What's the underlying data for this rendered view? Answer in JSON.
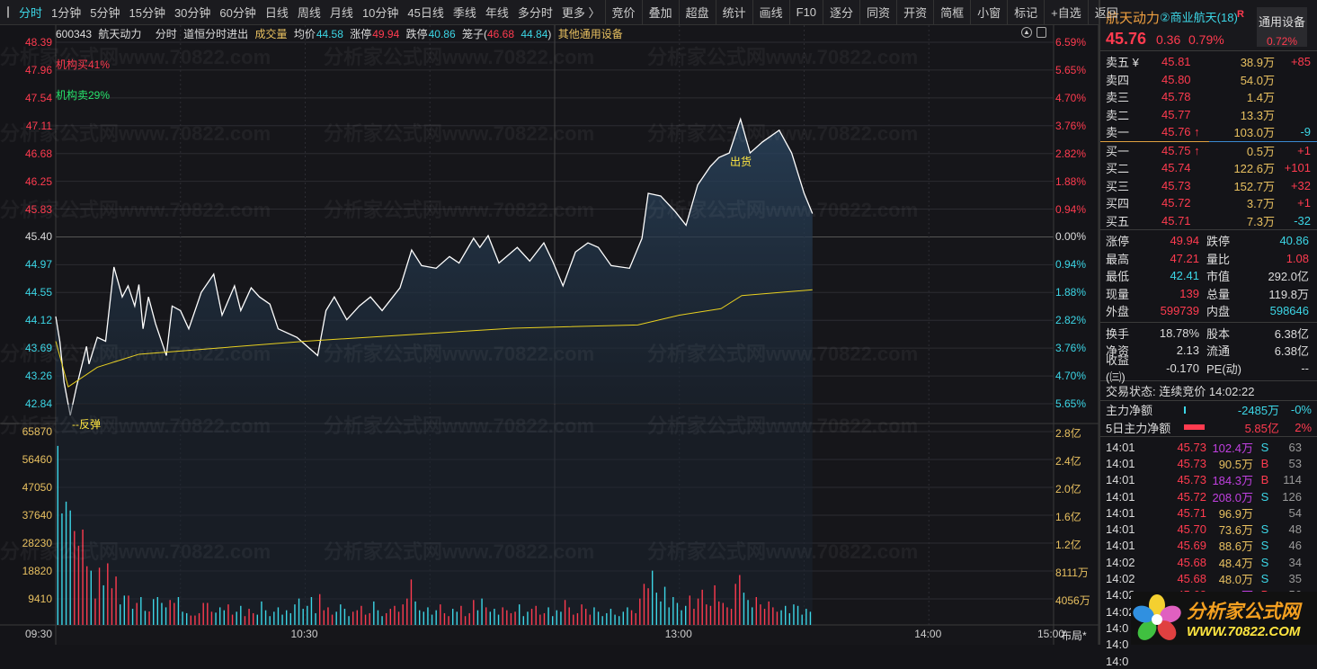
{
  "toolbar": {
    "periods": [
      "分时",
      "1分钟",
      "5分钟",
      "15分钟",
      "30分钟",
      "60分钟",
      "日线",
      "周线",
      "月线",
      "10分钟",
      "45日线",
      "季线",
      "年线",
      "多分时",
      "更多 〉"
    ],
    "actions": [
      "竞价",
      "叠加",
      "超盘",
      "统计",
      "画线",
      "F10",
      "逐分",
      "同资",
      "开资",
      "简框",
      "小窗",
      "标记",
      "+自选",
      "返回"
    ]
  },
  "header": {
    "code": "600343",
    "name": "航天动力",
    "mode": "分时",
    "indicator": "道恒分时进出",
    "vol_label": "成交量",
    "avg_label": "均价",
    "avg": "44.58",
    "up_label": "涨停",
    "up": "49.94",
    "down_label": "跌停",
    "down": "40.86",
    "cage_label": "笼子(",
    "cage_hi": "46.68",
    "cage_lo": "44.84",
    ")": ")",
    "industry": "其他通用设备"
  },
  "annotations": {
    "buy": "机构买41%",
    "sell": "机构卖29%",
    "rebound": "--反弹",
    "ship": "出货"
  },
  "watermark": "分析家公式网www.70822.com",
  "chart_data": {
    "type": "line",
    "price_axis": {
      "left": [
        "48.39",
        "47.96",
        "47.54",
        "47.11",
        "46.68",
        "46.25",
        "45.83",
        "45.40",
        "44.97",
        "44.55",
        "44.12",
        "43.69",
        "43.26",
        "42.84"
      ],
      "right": [
        "6.59%",
        "5.65%",
        "4.70%",
        "3.76%",
        "2.82%",
        "1.88%",
        "0.94%",
        "0.00%",
        "0.94%",
        "1.88%",
        "2.82%",
        "3.76%",
        "4.70%",
        "5.65%"
      ],
      "ylim": [
        42.84,
        48.39
      ],
      "prev_close": 45.4
    },
    "volume_axis": {
      "left": [
        "65870",
        "56460",
        "47050",
        "37640",
        "28230",
        "18820",
        "9410"
      ],
      "right": [
        "2.8亿",
        "2.4亿",
        "2.0亿",
        "1.6亿",
        "1.2亿",
        "8111万",
        "4056万"
      ],
      "ylim": [
        0,
        65870
      ]
    },
    "time_ticks": [
      "09:30",
      "10:30",
      "13:00",
      "14:00",
      "15:00"
    ],
    "total_minutes": 240,
    "price_keypoints": [
      [
        0,
        44.18
      ],
      [
        1,
        43.79
      ],
      [
        2,
        43.17
      ],
      [
        3.5,
        42.66
      ],
      [
        5,
        43.1
      ],
      [
        7.4,
        43.72
      ],
      [
        8,
        43.45
      ],
      [
        10,
        43.86
      ],
      [
        12,
        43.8
      ],
      [
        14,
        44.94
      ],
      [
        16,
        44.48
      ],
      [
        17.4,
        44.65
      ],
      [
        19,
        44.34
      ],
      [
        20,
        44.67
      ],
      [
        21,
        43.99
      ],
      [
        22.3,
        44.48
      ],
      [
        24,
        44.07
      ],
      [
        26.6,
        43.58
      ],
      [
        28,
        44.34
      ],
      [
        30,
        44.27
      ],
      [
        32,
        43.99
      ],
      [
        35,
        44.55
      ],
      [
        38,
        44.83
      ],
      [
        40,
        44.2
      ],
      [
        43,
        44.65
      ],
      [
        44.5,
        44.27
      ],
      [
        47,
        44.62
      ],
      [
        49,
        44.48
      ],
      [
        51.5,
        44.37
      ],
      [
        53.5,
        43.99
      ],
      [
        58,
        43.86
      ],
      [
        63,
        43.58
      ],
      [
        65,
        44.27
      ],
      [
        67,
        44.48
      ],
      [
        70,
        44.13
      ],
      [
        73,
        44.34
      ],
      [
        75.7,
        44.48
      ],
      [
        78.5,
        44.27
      ],
      [
        82.8,
        44.62
      ],
      [
        85.6,
        45.2
      ],
      [
        88,
        44.96
      ],
      [
        91.5,
        44.92
      ],
      [
        94.7,
        45.1
      ],
      [
        97,
        45.0
      ],
      [
        100.5,
        45.38
      ],
      [
        102,
        45.24
      ],
      [
        104,
        45.42
      ],
      [
        106.6,
        45.0
      ],
      [
        111,
        45.24
      ],
      [
        114,
        45.03
      ],
      [
        117.4,
        45.31
      ],
      [
        119.5,
        45.03
      ],
      [
        122,
        44.65
      ],
      [
        125,
        45.17
      ],
      [
        128,
        45.31
      ],
      [
        130.5,
        45.24
      ],
      [
        133.6,
        44.96
      ],
      [
        138,
        44.92
      ],
      [
        141,
        45.38
      ],
      [
        142.5,
        46.07
      ],
      [
        145.5,
        46.03
      ],
      [
        149,
        45.79
      ],
      [
        151.6,
        45.58
      ],
      [
        154.4,
        46.2
      ],
      [
        157.4,
        46.48
      ],
      [
        159.5,
        46.62
      ],
      [
        162,
        46.69
      ],
      [
        164.7,
        47.21
      ],
      [
        167,
        46.69
      ],
      [
        170,
        46.86
      ],
      [
        174,
        47.04
      ],
      [
        177,
        46.69
      ],
      [
        180,
        46.07
      ],
      [
        182,
        45.76
      ]
    ],
    "avg_keypoints": [
      [
        0,
        43.8
      ],
      [
        3,
        43.1
      ],
      [
        10,
        43.4
      ],
      [
        20,
        43.6
      ],
      [
        40,
        43.7
      ],
      [
        60,
        43.8
      ],
      [
        85,
        43.9
      ],
      [
        110,
        44.0
      ],
      [
        140,
        44.05
      ],
      [
        150,
        44.2
      ],
      [
        160,
        44.3
      ],
      [
        165,
        44.5
      ],
      [
        182,
        44.59
      ]
    ],
    "volume": [
      61000,
      38000,
      42000,
      39000,
      32000,
      27000,
      32500,
      20000,
      18500,
      9000,
      19500,
      13500,
      21000,
      12500,
      16500,
      7000,
      10000,
      10000,
      5500,
      7500,
      9500,
      4800,
      4600,
      8800,
      9500,
      7500,
      6000,
      8500,
      7500,
      9500,
      4500,
      4000,
      3200,
      3200,
      4000,
      7500,
      7500,
      4500,
      4200,
      6000,
      5000,
      7000,
      3500,
      4500,
      6500,
      3000,
      5500,
      4000,
      3500,
      8000,
      5000,
      3000,
      4500,
      6000,
      3500,
      5000,
      4000,
      7000,
      9000,
      5500,
      6500,
      9500,
      4000,
      10500,
      5000,
      6000,
      3500,
      4500,
      7000,
      5500,
      3000,
      4500,
      5000,
      6500,
      3500,
      4000,
      8000,
      5000,
      3000,
      4000,
      5500,
      6500,
      4500,
      7000,
      9000,
      15500,
      8000,
      5000,
      4500,
      6000,
      3500,
      5000,
      7000,
      4000,
      3000,
      5500,
      4500,
      6500,
      3000,
      4000,
      8500,
      5000,
      9000,
      6000,
      4500,
      5500,
      3500,
      6000,
      5000,
      4000,
      4500,
      7000,
      3000,
      4500,
      5500,
      6500,
      3500,
      4000,
      6000,
      3000,
      5000,
      4500,
      8500,
      6000,
      3500,
      4000,
      7000,
      5500,
      3500,
      6000,
      4500,
      3000,
      4000,
      5500,
      3500,
      3000,
      4500,
      6000,
      5000,
      4000,
      9000,
      14000,
      12500,
      18500,
      11000,
      8000,
      13000,
      6000,
      9500,
      7500,
      5000,
      6500,
      10000,
      5500,
      9000,
      12000,
      7000,
      6500,
      13500,
      8000,
      7500,
      6000,
      5500,
      14000,
      17000,
      11000,
      8500,
      6000,
      9500,
      7000,
      5500,
      8000,
      6000,
      4500,
      5000,
      6500,
      4000,
      7000,
      6500,
      3500,
      5500,
      4500
    ]
  },
  "layout_btn": "布局*",
  "side": {
    "name": "航天动力",
    "concept": "②商业航天(18)",
    "r": "R",
    "sector": "通用设备",
    "sector_pct": "0.72%",
    "price": "45.76",
    "change": "0.36",
    "pct": "0.79%",
    "asks": [
      [
        "卖五 ¥",
        "45.81",
        "38.9万",
        "+85"
      ],
      [
        "卖四",
        "45.80",
        "54.0万",
        ""
      ],
      [
        "卖三",
        "45.78",
        "1.4万",
        ""
      ],
      [
        "卖二",
        "45.77",
        "13.3万",
        ""
      ],
      [
        "卖一",
        "45.76 ↑",
        "103.0万",
        "-9"
      ]
    ],
    "bids": [
      [
        "买一",
        "45.75 ↑",
        "0.5万",
        "+1"
      ],
      [
        "买二",
        "45.74",
        "122.6万",
        "+101"
      ],
      [
        "买三",
        "45.73",
        "152.7万",
        "+32"
      ],
      [
        "买四",
        "45.72",
        "3.7万",
        "+1"
      ],
      [
        "买五",
        "45.71",
        "7.3万",
        "-32"
      ]
    ],
    "stats1": [
      [
        "涨停",
        "49.94",
        "red",
        "跌停",
        "40.86",
        "cyan"
      ],
      [
        "最高",
        "47.21",
        "red",
        "量比",
        "1.08",
        "red"
      ],
      [
        "最低",
        "42.41",
        "cyan",
        "市值",
        "292.0亿",
        "wht"
      ],
      [
        "现量",
        "139",
        "red",
        "总量",
        "119.8万",
        "wht"
      ],
      [
        "外盘",
        "599739",
        "red",
        "内盘",
        "598646",
        "cyan"
      ]
    ],
    "stats2": [
      [
        "换手",
        "18.78%",
        "股本",
        "6.38亿"
      ],
      [
        "净资",
        "2.13",
        "流通",
        "6.38亿"
      ],
      [
        "收益(㈢)",
        "-0.170",
        "PE(动)",
        "--"
      ]
    ],
    "status": "交易状态: 连续竞价 14:02:22",
    "flow": [
      [
        "主力净额",
        "-2485万",
        "-0%"
      ],
      [
        "5日主力净额",
        "5.85亿",
        "2%"
      ]
    ],
    "ticks": [
      [
        "14:01",
        "45.73",
        "102.4万",
        "S",
        "63"
      ],
      [
        "14:01",
        "45.73",
        "90.5万",
        "B",
        "53"
      ],
      [
        "14:01",
        "45.73",
        "184.3万",
        "B",
        "114"
      ],
      [
        "14:01",
        "45.72",
        "208.0万",
        "S",
        "126"
      ],
      [
        "14:01",
        "45.71",
        "96.9万",
        "",
        "54"
      ],
      [
        "14:01",
        "45.70",
        "73.6万",
        "S",
        "48"
      ],
      [
        "14:01",
        "45.69",
        "88.6万",
        "S",
        "46"
      ],
      [
        "14:02",
        "45.68",
        "48.4万",
        "S",
        "34"
      ],
      [
        "14:02",
        "45.68",
        "48.0万",
        "S",
        "35"
      ],
      [
        "14:02",
        "45.68",
        "102.8万",
        "B",
        "56"
      ],
      [
        "14:02",
        "45.69",
        "97.8万",
        "B",
        "67"
      ],
      [
        "14:0",
        "",
        "",
        "",
        ""
      ],
      [
        "14:0",
        "",
        "",
        "",
        ""
      ],
      [
        "14:0",
        "",
        "",
        "",
        ""
      ]
    ]
  },
  "logo": {
    "cn": "分析家公式网",
    "url": "WWW.70822.COM"
  }
}
